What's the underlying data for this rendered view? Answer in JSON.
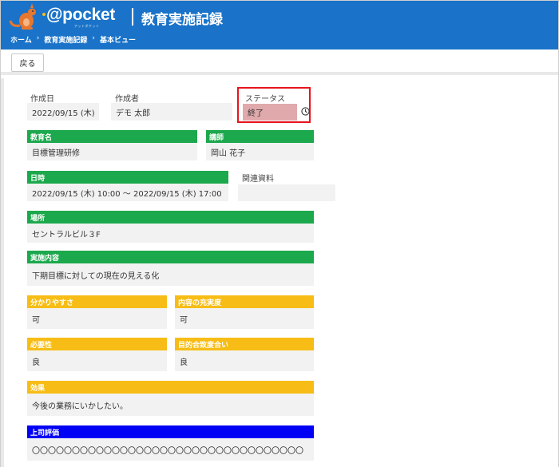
{
  "header": {
    "logo_text": "@pocket",
    "logo_sub": "アットポケット",
    "title": "教育実施記録",
    "breadcrumb": [
      "ホーム",
      "教育実施記録",
      "基本ビュー"
    ],
    "breadcrumb_sep": "›",
    "color": "#1a73c8"
  },
  "toolbar": {
    "back_label": "戻る"
  },
  "form": {
    "created_date": {
      "label": "作成日",
      "value": "2022/09/15 (木)"
    },
    "creator": {
      "label": "作成者",
      "value": "デモ 太郎"
    },
    "status": {
      "label": "ステータス",
      "value": "終了",
      "icon": "clock-icon"
    },
    "course_name": {
      "label": "教育名",
      "value": "目標管理研修"
    },
    "instructor": {
      "label": "講師",
      "value": "岡山 花子"
    },
    "datetime": {
      "label": "日時",
      "value": "2022/09/15 (木) 10:00 ～ 2022/09/15 (木) 17:00"
    },
    "related_docs": {
      "label": "関連資料",
      "value": ""
    },
    "location": {
      "label": "場所",
      "value": "セントラルビル３F"
    },
    "content": {
      "label": "実施内容",
      "value": "下期目標に対しての現在の見える化"
    },
    "clarity": {
      "label": "分かりやすさ",
      "value": "可"
    },
    "fulfillment": {
      "label": "内容の充実度",
      "value": "可"
    },
    "necessity": {
      "label": "必要性",
      "value": "良"
    },
    "goal_fit": {
      "label": "目的合致度合い",
      "value": "良"
    },
    "effect": {
      "label": "効果",
      "value": "今後の業務にいかしたい。"
    },
    "supervisor_eval": {
      "label": "上司評価",
      "value": "〇〇〇〇〇〇〇〇〇〇〇〇〇〇〇〇〇〇〇〇〇〇〇〇〇〇〇〇〇〇〇〇〇〇"
    }
  },
  "colors": {
    "green": "#1ca84c",
    "yellow": "#f7bd16",
    "blue": "#0000f5",
    "highlight": "#e8141c"
  }
}
